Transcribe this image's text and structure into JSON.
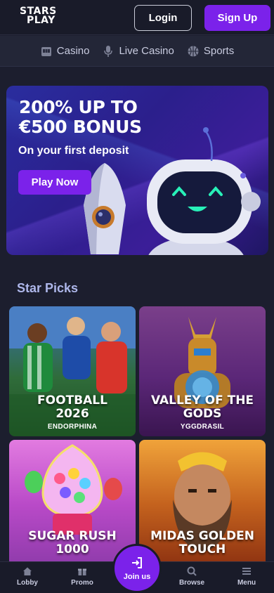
{
  "header": {
    "logo_line1": "STARS",
    "logo_line2": "PLAY",
    "login_label": "Login",
    "signup_label": "Sign Up"
  },
  "categories": [
    {
      "label": "Casino",
      "icon": "slot-machine-icon"
    },
    {
      "label": "Live Casino",
      "icon": "microphone-icon"
    },
    {
      "label": "Sports",
      "icon": "basketball-icon"
    }
  ],
  "banner": {
    "title_line1": "200% UP TO",
    "title_line2": "€500 BONUS",
    "subtitle": "On your first deposit",
    "cta_label": "Play Now"
  },
  "section": {
    "title": "Star Picks"
  },
  "games": [
    {
      "name_line1": "FOOTBALL",
      "name_line2": "2026",
      "provider": "ENDORPHINA"
    },
    {
      "name_line1": "VALLEY OF THE",
      "name_line2": "GODS",
      "provider": "YGGDRASIL"
    },
    {
      "name_line1": "SUGAR RUSH",
      "name_line2": "1000",
      "provider": ""
    },
    {
      "name_line1": "MIDAS GOLDEN",
      "name_line2": "TOUCH",
      "provider": ""
    }
  ],
  "bottom_nav": {
    "lobby": "Lobby",
    "promo": "Promo",
    "join": "Join us",
    "browse": "Browse",
    "menu": "Menu"
  },
  "colors": {
    "accent": "#7b22ea",
    "background": "#1c1e2e",
    "section_title": "#aeb7ea"
  }
}
